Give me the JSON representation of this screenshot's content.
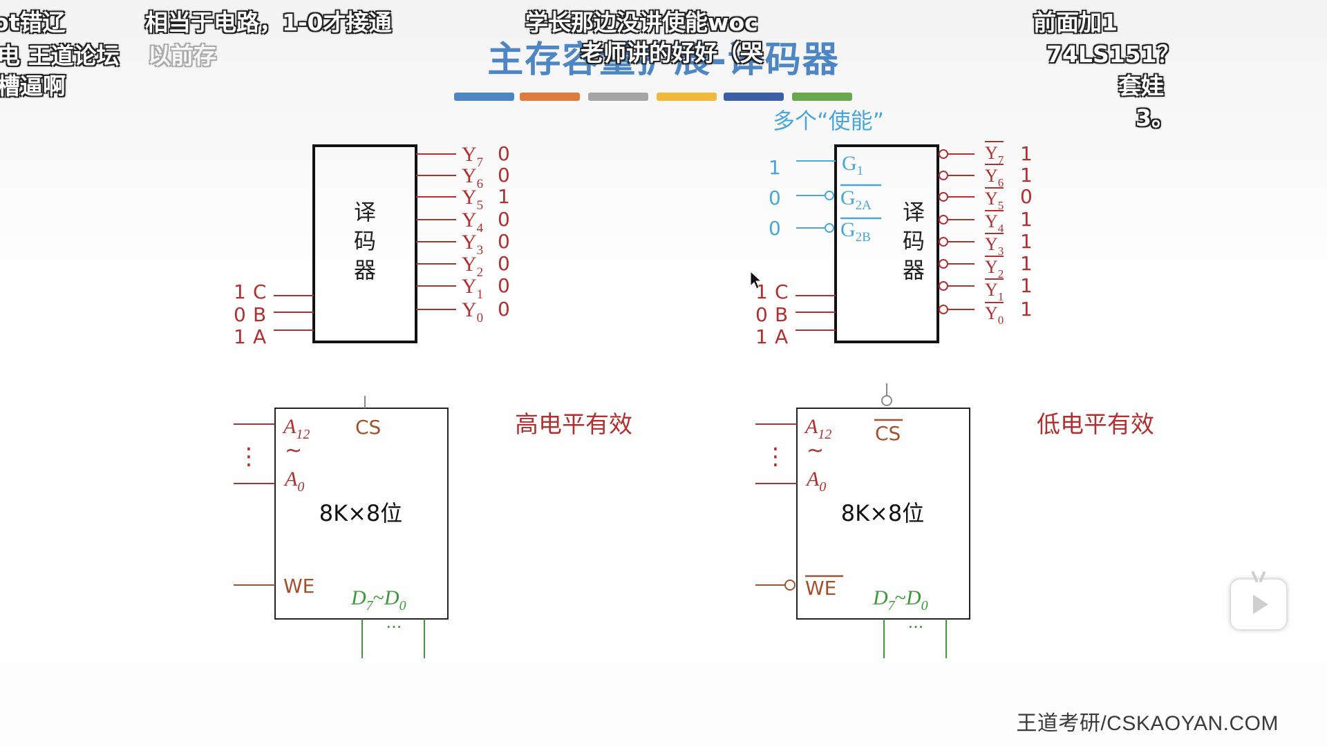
{
  "slide": {
    "title": "主存容量扩展-译码器",
    "enable_note": "多个“使能”",
    "colors": {
      "accent_blue": "#4e86c4",
      "signal_red": "#b03030",
      "cs_brown": "#a0522d",
      "data_green": "#3a9a3a",
      "enable_blue": "#49a6d8",
      "bar_colors": [
        "#4e86c4",
        "#e07b3e",
        "#a5a5a5",
        "#f0b93a",
        "#3d5fa8",
        "#6aa84f"
      ]
    },
    "left_decoder": {
      "label": "译码器",
      "outputs": [
        {
          "name": "Y7",
          "sub": "7",
          "value": "0"
        },
        {
          "name": "Y6",
          "sub": "6",
          "value": "0"
        },
        {
          "name": "Y5",
          "sub": "5",
          "value": "1"
        },
        {
          "name": "Y4",
          "sub": "4",
          "value": "0"
        },
        {
          "name": "Y3",
          "sub": "3",
          "value": "0"
        },
        {
          "name": "Y2",
          "sub": "2",
          "value": "0"
        },
        {
          "name": "Y1",
          "sub": "1",
          "value": "0"
        },
        {
          "name": "Y0",
          "sub": "0",
          "value": "0"
        }
      ],
      "inputs": [
        {
          "name": "C",
          "value": "1"
        },
        {
          "name": "B",
          "value": "0"
        },
        {
          "name": "A",
          "value": "1"
        }
      ]
    },
    "right_decoder": {
      "label": "译码器",
      "enables": [
        {
          "name": "G",
          "sub": "1",
          "value": "1",
          "inverted": false
        },
        {
          "name": "G",
          "sub": "2A",
          "value": "0",
          "inverted": true
        },
        {
          "name": "G",
          "sub": "2B",
          "value": "0",
          "inverted": true
        }
      ],
      "outputs": [
        {
          "name": "Y7",
          "sub": "7",
          "value": "1"
        },
        {
          "name": "Y6",
          "sub": "6",
          "value": "1"
        },
        {
          "name": "Y5",
          "sub": "5",
          "value": "0"
        },
        {
          "name": "Y4",
          "sub": "4",
          "value": "1"
        },
        {
          "name": "Y3",
          "sub": "3",
          "value": "1"
        },
        {
          "name": "Y2",
          "sub": "2",
          "value": "1"
        },
        {
          "name": "Y1",
          "sub": "1",
          "value": "1"
        },
        {
          "name": "Y0",
          "sub": "0",
          "value": "1"
        }
      ],
      "inputs": [
        {
          "name": "C",
          "value": "1"
        },
        {
          "name": "B",
          "value": "0"
        },
        {
          "name": "A",
          "value": "1"
        }
      ]
    },
    "left_chip": {
      "addr_high": "A",
      "addr_high_sub": "12",
      "tilde": "~",
      "addr_low": "A",
      "addr_low_sub": "0",
      "cs": "CS",
      "capacity": "8K×8位",
      "we": "WE",
      "data_hi": "D",
      "data_hi_sub": "7",
      "data_lo": "D",
      "data_lo_sub": "0",
      "dots": "···",
      "vdots": "⋮",
      "note": "高电平有效"
    },
    "right_chip": {
      "addr_high": "A",
      "addr_high_sub": "12",
      "tilde": "~",
      "addr_low": "A",
      "addr_low_sub": "0",
      "cs": "CS",
      "capacity": "8K×8位",
      "we": "WE",
      "data_hi": "D",
      "data_hi_sub": "7",
      "data_lo": "D",
      "data_lo_sub": "0",
      "dots": "···",
      "vdots": "⋮",
      "note": "低电平有效"
    },
    "watermark": "王道考研/CSKAOYAN.COM"
  },
  "danmaku": [
    {
      "text": "ot错辽"
    },
    {
      "text": "相当于电路，1-0才接通"
    },
    {
      "text": "学长那边没讲使能woc"
    },
    {
      "text": "前面加1"
    },
    {
      "text": "电  王道论坛"
    },
    {
      "text": "以前存"
    },
    {
      "text": "老师讲的好好（哭"
    },
    {
      "text": "74LS151？"
    },
    {
      "text": "槽逼啊"
    },
    {
      "text": "套娃"
    },
    {
      "text": "3。"
    }
  ],
  "player": {
    "play_icon": "play-icon"
  }
}
